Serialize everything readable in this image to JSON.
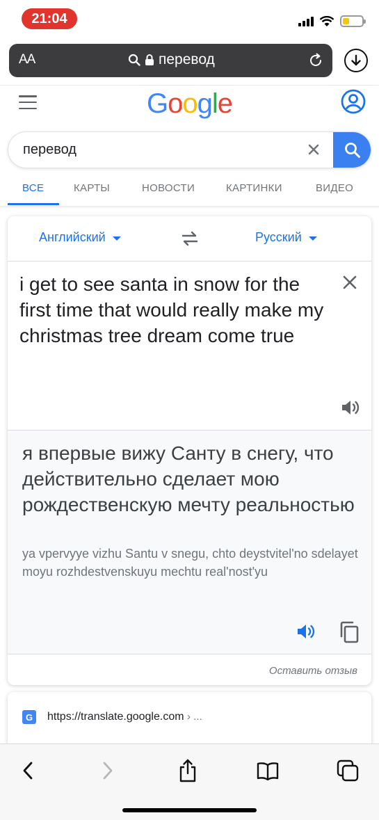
{
  "status_bar": {
    "time": "21:04"
  },
  "browser": {
    "text_size_label": "AA",
    "address": "перевод"
  },
  "google": {
    "logo_letters": [
      "G",
      "o",
      "o",
      "g",
      "l",
      "e"
    ],
    "logo_colors": [
      "#4285F4",
      "#EA4335",
      "#FBBC05",
      "#4285F4",
      "#34A853",
      "#EA4335"
    ],
    "search_query": "перевод",
    "tabs": [
      {
        "label": "ВСЕ",
        "active": true
      },
      {
        "label": "КАРТЫ",
        "active": false
      },
      {
        "label": "НОВОСТИ",
        "active": false
      },
      {
        "label": "КАРТИНКИ",
        "active": false
      },
      {
        "label": "ВИДЕО",
        "active": false
      }
    ]
  },
  "translate": {
    "source_language": "Английский",
    "target_language": "Русский",
    "source_text": "i get to see santa in snow for the first time that would really make my christmas tree dream come true",
    "translated_text": "я впервые вижу Санту в снегу, что действительно сделает мою рождественскую мечту реальностью",
    "transliteration": "ya vpervyye vizhu Santu v snegu, chto deystvitel'no sdelayet moyu rozhdestvenskuyu mechtu real'nost'yu",
    "feedback_label": "Оставить отзыв"
  },
  "result": {
    "url": "https://translate.google.com",
    "breadcrumb": "› ..."
  },
  "colors": {
    "accent_blue": "#1a73e8",
    "search_button": "#3b80f0",
    "time_pill": "#e0342d",
    "address_bar": "#3c3c3e"
  }
}
